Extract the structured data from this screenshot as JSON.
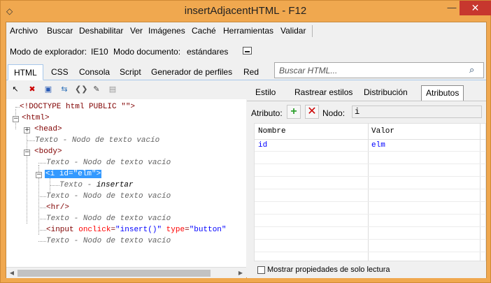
{
  "window": {
    "title": "insertAdjacentHTML - F12",
    "minimize": "—",
    "close": "✕"
  },
  "menu": [
    "Archivo",
    "Buscar",
    "Deshabilitar",
    "Ver",
    "Imágenes",
    "Caché",
    "Herramientas",
    "Validar"
  ],
  "modebar": {
    "browser_label": "Modo de explorador:",
    "browser_value": "IE10",
    "doc_label": "Modo documento:",
    "doc_value": "estándares"
  },
  "tabs": [
    "HTML",
    "CSS",
    "Consola",
    "Script",
    "Generador de perfiles",
    "Red"
  ],
  "active_tab": "HTML",
  "search": {
    "placeholder": "Buscar HTML..."
  },
  "tree": {
    "doctype": "<!DOCTYPE html PUBLIC \"\">",
    "html_open": "<html>",
    "head": "<head>",
    "text_label": "Texto",
    "text_sep": " - ",
    "empty_text": "Nodo de texto vacío",
    "body": "<body>",
    "i_open": "<i",
    "i_attr": "id",
    "i_eq": "=",
    "i_val": "\"elm\"",
    "i_close": ">",
    "insert_text": "insertar",
    "hr": "<hr/>",
    "input_open": "<input",
    "input_attr1": "onclick",
    "input_val1": "\"insert()\"",
    "input_attr2": "type",
    "input_val2": "\"button\""
  },
  "right_tabs": [
    "Estilo",
    "Rastrear estilos",
    "Distribución",
    "Atributos"
  ],
  "active_right_tab": "Atributos",
  "attr_bar": {
    "attr_label": "Atributo:",
    "node_label": "Nodo:",
    "node_value": "i"
  },
  "grid": {
    "headers": [
      "Nombre",
      "Valor"
    ],
    "rows": [
      {
        "name": "id",
        "value": "elm"
      }
    ]
  },
  "footer": {
    "readonly_label": "Mostrar propiedades de solo lectura"
  }
}
